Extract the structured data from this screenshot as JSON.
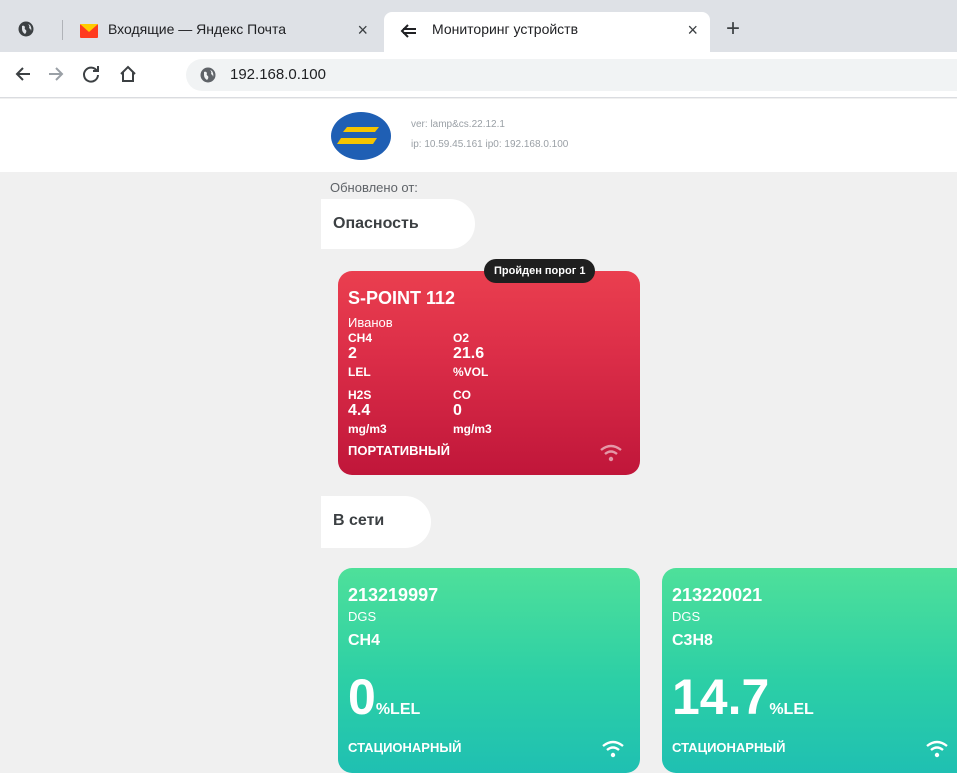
{
  "browser": {
    "tabs": [
      {
        "title": "Входящие — Яндекс Почта",
        "icon": "yandex-mail-icon",
        "close": "×"
      },
      {
        "title": "Мониторинг устройств",
        "icon": "back-arrow-favicon",
        "close": "×"
      }
    ],
    "new_tab": "+",
    "url": "192.168.0.100"
  },
  "header": {
    "version": "ver: lamp&cs.22.12.1",
    "ip": "ip: 10.59.45.161 ip0: 192.168.0.100"
  },
  "updated_label": "Обновлено от:",
  "sections": {
    "danger": {
      "title": "Опасность",
      "device": {
        "badge": "Пройден порог 1",
        "name": "S-POINT 112",
        "owner": "Иванов",
        "gases": [
          {
            "name": "CH4",
            "value": "2",
            "unit": "LEL"
          },
          {
            "name": "O2",
            "value": "21.6",
            "unit": "%VOL"
          },
          {
            "name": "H2S",
            "value": "4.4",
            "unit": "mg/m3"
          },
          {
            "name": "CO",
            "value": "0",
            "unit": "mg/m3"
          }
        ],
        "type": "ПОРТАТИВНЫЙ"
      }
    },
    "online": {
      "title": "В сети",
      "devices": [
        {
          "id": "213219997",
          "model": "DGS",
          "gas": "CH4",
          "value": "0",
          "unit": "%LEL",
          "type": "СТАЦИОНАРНЫЙ"
        },
        {
          "id": "213220021",
          "model": "DGS",
          "gas": "C3H8",
          "value": "14.7",
          "unit": "%LEL",
          "type": "СТАЦИОНАРНЫЙ"
        }
      ]
    }
  },
  "colors": {
    "danger_card": "#dc2e48",
    "online_card": "#2ccfa6",
    "logo_blue": "#1f5fb4",
    "logo_yellow": "#f5c400"
  }
}
